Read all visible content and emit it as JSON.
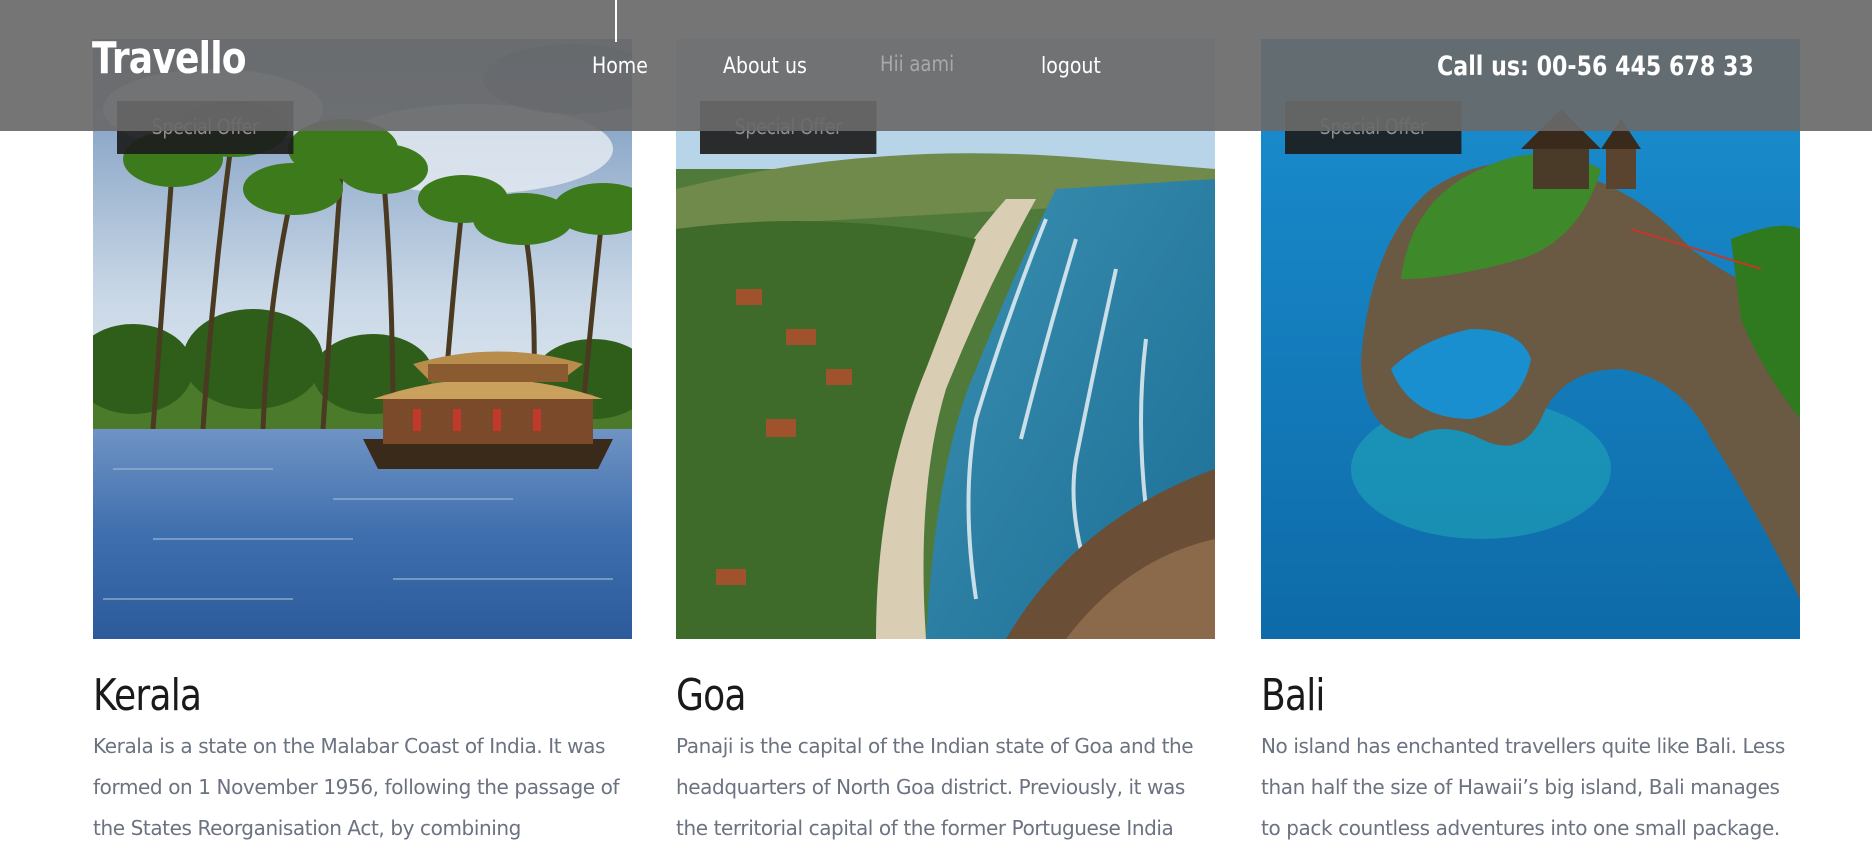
{
  "brand": {
    "name": "Travello"
  },
  "nav": {
    "home": "Home",
    "about": "About us",
    "user_greeting": "Hii aami",
    "logout": "logout"
  },
  "contact": {
    "call": "Call us: 00-56 445 678 33"
  },
  "cards": [
    {
      "badge": "Special Offer",
      "title": "Kerala",
      "desc_lines": [
        "Kerala is a state on the Malabar Coast of India. It was",
        "formed on 1 November 1956, following the passage of",
        "the States Reorganisation Act, by combining"
      ],
      "image": "kerala-houseboat-backwaters"
    },
    {
      "badge": "Special Offer",
      "title": "Goa",
      "desc_lines": [
        "Panaji is the capital of the Indian state of Goa and the",
        "headquarters of North Goa district. Previously, it was",
        "the territorial capital of the former Portuguese India"
      ],
      "image": "goa-beach-coastline"
    },
    {
      "badge": "Special Offer",
      "title": "Bali",
      "desc_lines": [
        "No island has enchanted travellers quite like Bali. Less",
        "than half the size of Hawaii’s big island, Bali manages",
        "to pack countless adventures into one small package."
      ],
      "image": "bali-sea-temple-cliff"
    }
  ],
  "colors": {
    "header_overlay": "#696969",
    "badge_bg": "#1c1c1c",
    "title_text": "#1a1a1a",
    "desc_text": "#6b7280"
  }
}
